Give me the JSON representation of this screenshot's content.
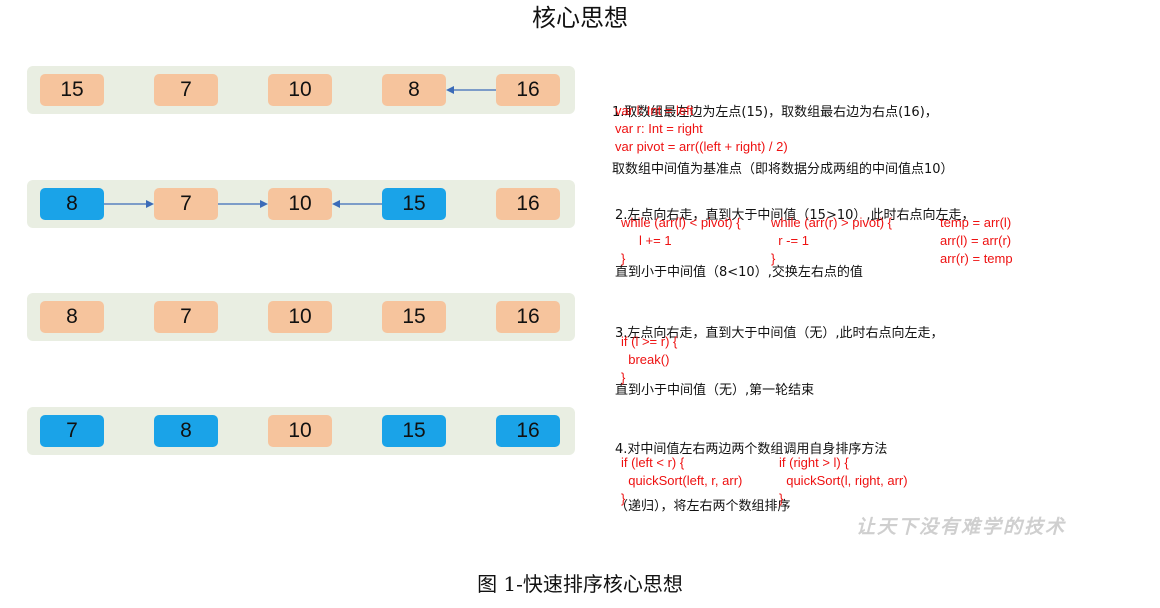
{
  "title": "核心思想",
  "caption": "图 1-快速排序核心思想",
  "watermark": "让天下没有难学的技术",
  "rows": [
    {
      "cells": [
        {
          "value": "15",
          "state": "normal"
        },
        {
          "value": "7",
          "state": "normal"
        },
        {
          "value": "10",
          "state": "normal"
        },
        {
          "value": "8",
          "state": "normal"
        },
        {
          "value": "16",
          "state": "normal"
        }
      ]
    },
    {
      "cells": [
        {
          "value": "8",
          "state": "active"
        },
        {
          "value": "7",
          "state": "normal"
        },
        {
          "value": "10",
          "state": "normal"
        },
        {
          "value": "15",
          "state": "active"
        },
        {
          "value": "16",
          "state": "normal"
        }
      ]
    },
    {
      "cells": [
        {
          "value": "8",
          "state": "normal"
        },
        {
          "value": "7",
          "state": "normal"
        },
        {
          "value": "10",
          "state": "normal"
        },
        {
          "value": "15",
          "state": "normal"
        },
        {
          "value": "16",
          "state": "normal"
        }
      ]
    },
    {
      "cells": [
        {
          "value": "7",
          "state": "active"
        },
        {
          "value": "8",
          "state": "active"
        },
        {
          "value": "10",
          "state": "normal"
        },
        {
          "value": "15",
          "state": "active"
        },
        {
          "value": "16",
          "state": "active"
        }
      ]
    }
  ],
  "steps": [
    {
      "desc_line1": "1.取数组最左边为左点(15)，取数组最右边为右点(16)，",
      "desc_line2": "取数组中间值为基准点（即将数据分成两组的中间值点10）",
      "code1": "var l: Int = left\nvar r: Int = right\nvar pivot = arr((left + right) / 2)"
    },
    {
      "desc_line1": "2.左点向右走，直到大于中间值（15>10）,此时右点向左走，",
      "desc_line2": "直到小于中间值（8<10）,交换左右点的值",
      "code1": "while (arr(l) < pivot) {\n     l += 1\n}",
      "code2": "while (arr(r) > pivot) {\n  r -= 1\n}",
      "code3": "temp = arr(l)\narr(l) = arr(r)\narr(r) = temp"
    },
    {
      "desc_line1": "3.左点向右走，直到大于中间值（无）,此时右点向左走，",
      "desc_line2": "直到小于中间值（无）,第一轮结束",
      "code1": "if (l >= r) {\n  break()\n}"
    },
    {
      "desc_line1": "4.对中间值左右两边两个数组调用自身排序方法",
      "desc_line2": "（递归），将左右两个数组排序",
      "code1": "if (left < r) {\n  quickSort(left, r, arr)\n}",
      "code2": "if (right > l) {\n  quickSort(l, right, arr)\n}"
    }
  ],
  "colors": {
    "row_background": "#e9eee2",
    "cell_normal": "#f6c49d",
    "cell_active": "#1aa3e8",
    "arrow": "#3b6bb8",
    "code": "#ee1111"
  }
}
